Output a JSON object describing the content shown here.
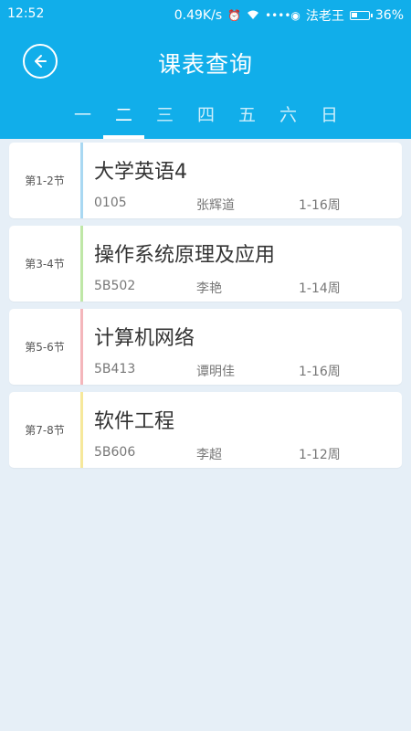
{
  "status_bar": {
    "time": "12:52",
    "speed": "0.49K/s",
    "carrier": "法老王",
    "battery": "36%",
    "battery_level": 0.36
  },
  "header": {
    "title": "课表查询",
    "back_icon": "back-arrow-icon"
  },
  "day_tabs": [
    {
      "label": "一"
    },
    {
      "label": "二",
      "active": true
    },
    {
      "label": "三"
    },
    {
      "label": "四"
    },
    {
      "label": "五"
    },
    {
      "label": "六"
    },
    {
      "label": "日"
    }
  ],
  "courses": [
    {
      "period": "第1-2节",
      "name": "大学英语4",
      "room": "0105",
      "teacher": "张辉道",
      "weeks": "1-16周",
      "color": "#a9d8f2"
    },
    {
      "period": "第3-4节",
      "name": "操作系统原理及应用",
      "room": "5B502",
      "teacher": "李艳",
      "weeks": "1-14周",
      "color": "#bfe7a7"
    },
    {
      "period": "第5-6节",
      "name": "计算机网络",
      "room": "5B413",
      "teacher": "谭明佳",
      "weeks": "1-16周",
      "color": "#f4b6bb"
    },
    {
      "period": "第7-8节",
      "name": "软件工程",
      "room": "5B606",
      "teacher": "李超",
      "weeks": "1-12周",
      "color": "#f6e89b"
    }
  ],
  "colors": {
    "header": "#11aeea",
    "background": "#e6eff7"
  }
}
